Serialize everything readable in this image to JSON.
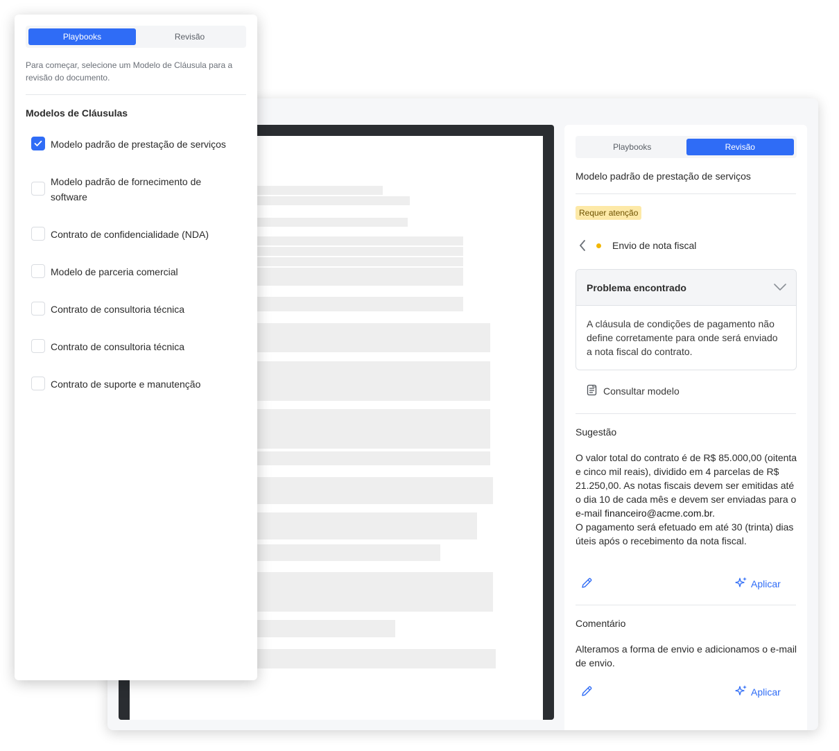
{
  "playbook_panel": {
    "tabs": [
      {
        "label": "Playbooks",
        "active": true
      },
      {
        "label": "Revisão",
        "active": false
      }
    ],
    "intro": "Para começar, selecione um Modelo de Cláusula para a revisão do documento.",
    "heading": "Modelos de Cláusulas",
    "options": [
      {
        "label": "Modelo padrão de prestação de serviços",
        "checked": true
      },
      {
        "label": "Modelo padrão de fornecimento de software",
        "checked": false
      },
      {
        "label": "Contrato de confidencialidade (NDA)",
        "checked": false
      },
      {
        "label": "Modelo de parceria comercial",
        "checked": false
      },
      {
        "label": "Contrato de consultoria técnica",
        "checked": false
      },
      {
        "label": "Contrato de consultoria técnica",
        "checked": false
      },
      {
        "label": "Contrato de suporte e manutenção",
        "checked": false
      }
    ]
  },
  "review_panel": {
    "tabs": [
      {
        "label": "Playbooks",
        "active": false
      },
      {
        "label": "Revisão",
        "active": true
      }
    ],
    "title": "Modelo padrão de prestação de serviços",
    "badge": "Requer atenção",
    "issue_label": "Envio de nota fiscal",
    "problem": {
      "heading": "Problema encontrado",
      "text": "A cláusula de condições de pagamento não define corretamente para onde será enviado a nota fiscal do contrato."
    },
    "consult_label": "Consultar modelo",
    "suggestion": {
      "heading": "Sugestão",
      "text_1": "O valor total do contrato é de R$ 85.000,00 (oitenta e cinco mil reais), dividido em 4 parcelas de R$ 21.250,00. As notas fiscais devem ser emitidas até o dia 10 de cada mês e devem ser enviadas para o e-mail ",
      "email": "financeiro@acme.com.br.",
      "text_2": "O pagamento será efetuado em até 30 (trinta) dias úteis após o recebimento da nota fiscal.",
      "apply_label": "Aplicar"
    },
    "comment": {
      "heading": "Comentário",
      "text": "Alteramos a forma de envio e adicionamos o e-mail de envio.",
      "apply_label": "Aplicar"
    }
  },
  "colors": {
    "accent": "#2f6cf6",
    "badge_bg": "#fde9a7",
    "warning_dot": "#f2b705",
    "doc_frame": "#2a2d31"
  },
  "icons": {
    "check": "check-icon",
    "back": "chevron-left-icon",
    "collapse": "chevron-down-icon",
    "document": "document-icon",
    "edit": "pencil-icon",
    "ai": "sparkles-icon"
  }
}
